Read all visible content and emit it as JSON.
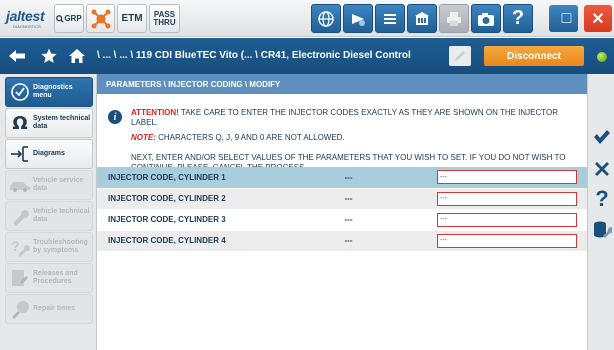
{
  "topbar": {
    "logo": "jaltest",
    "logo_sub": "DIAGNOSTICS",
    "grp_label": "GRP",
    "etm_label": "ETM",
    "pass_label": "PASS",
    "thru_label": "THRU",
    "help_label": "?",
    "minimize_label": "_",
    "maximize_label": "□",
    "close_label": "✕"
  },
  "navbar": {
    "breadcrumb": "\\ ... \\ ... \\ 119 CDI BlueTEC Vito (... \\ CR41, Electronic Diesel Control",
    "disconnect_label": "Disconnect"
  },
  "sidebar": {
    "items": [
      {
        "label": "Diagnostics menu",
        "icon": "diagnostics-icon",
        "state": "active"
      },
      {
        "label": "System technical data",
        "icon": "ohm-icon",
        "state": "enabled"
      },
      {
        "label": "Diagrams",
        "icon": "diagram-icon",
        "state": "enabled"
      },
      {
        "label": "Vehicle service data",
        "icon": "vehicle-icon",
        "state": "disabled"
      },
      {
        "label": "Vehicle technical data",
        "icon": "wrench-icon",
        "state": "disabled"
      },
      {
        "label": "Troubleshooting by symptoms",
        "icon": "question-wrench-icon",
        "state": "disabled"
      },
      {
        "label": "Releases and Procedures",
        "icon": "procedure-icon",
        "state": "disabled"
      },
      {
        "label": "Repair times",
        "icon": "repair-times-icon",
        "state": "disabled"
      }
    ]
  },
  "main": {
    "title": "PARAMETERS \\ INJECTOR CODING \\ MODIFY",
    "attention_label": "ATTENTION!",
    "attention_text": " TAKE CARE TO ENTER THE INJECTOR CODES EXACTLY AS THEY ARE SHOWN ON THE INJECTOR LABEL.",
    "note_label": "NOTE:",
    "note_text": " CHARACTERS Q, J, 9 AND 0 ARE NOT ALLOWED.",
    "next_text": "NEXT, ENTER AND/OR SELECT VALUES OF THE PARAMETERS THAT YOU WISH TO SET. IF YOU DO NOT WISH TO CONTINUE, PLEASE, CANCEL THE PROCESS...",
    "rows": [
      {
        "name": "INJECTOR CODE, CYLINDER 1",
        "current": "---",
        "input": "---"
      },
      {
        "name": "INJECTOR CODE, CYLINDER 2",
        "current": "---",
        "input": "---"
      },
      {
        "name": "INJECTOR CODE, CYLINDER 3",
        "current": "---",
        "input": "---"
      },
      {
        "name": "INJECTOR CODE, CYLINDER 4",
        "current": "---",
        "input": "---"
      }
    ]
  },
  "rightbar": {
    "help_label": "?"
  },
  "colors": {
    "nav_blue": "#1f5d94",
    "title_blue": "#5f8fbe",
    "highlight_row": "#a8cede",
    "alt_row": "#ececed",
    "accent_orange": "#f08d1e",
    "close_red": "#e2442f",
    "alert_red": "#e02020",
    "check_blue": "#1a4f7e"
  }
}
